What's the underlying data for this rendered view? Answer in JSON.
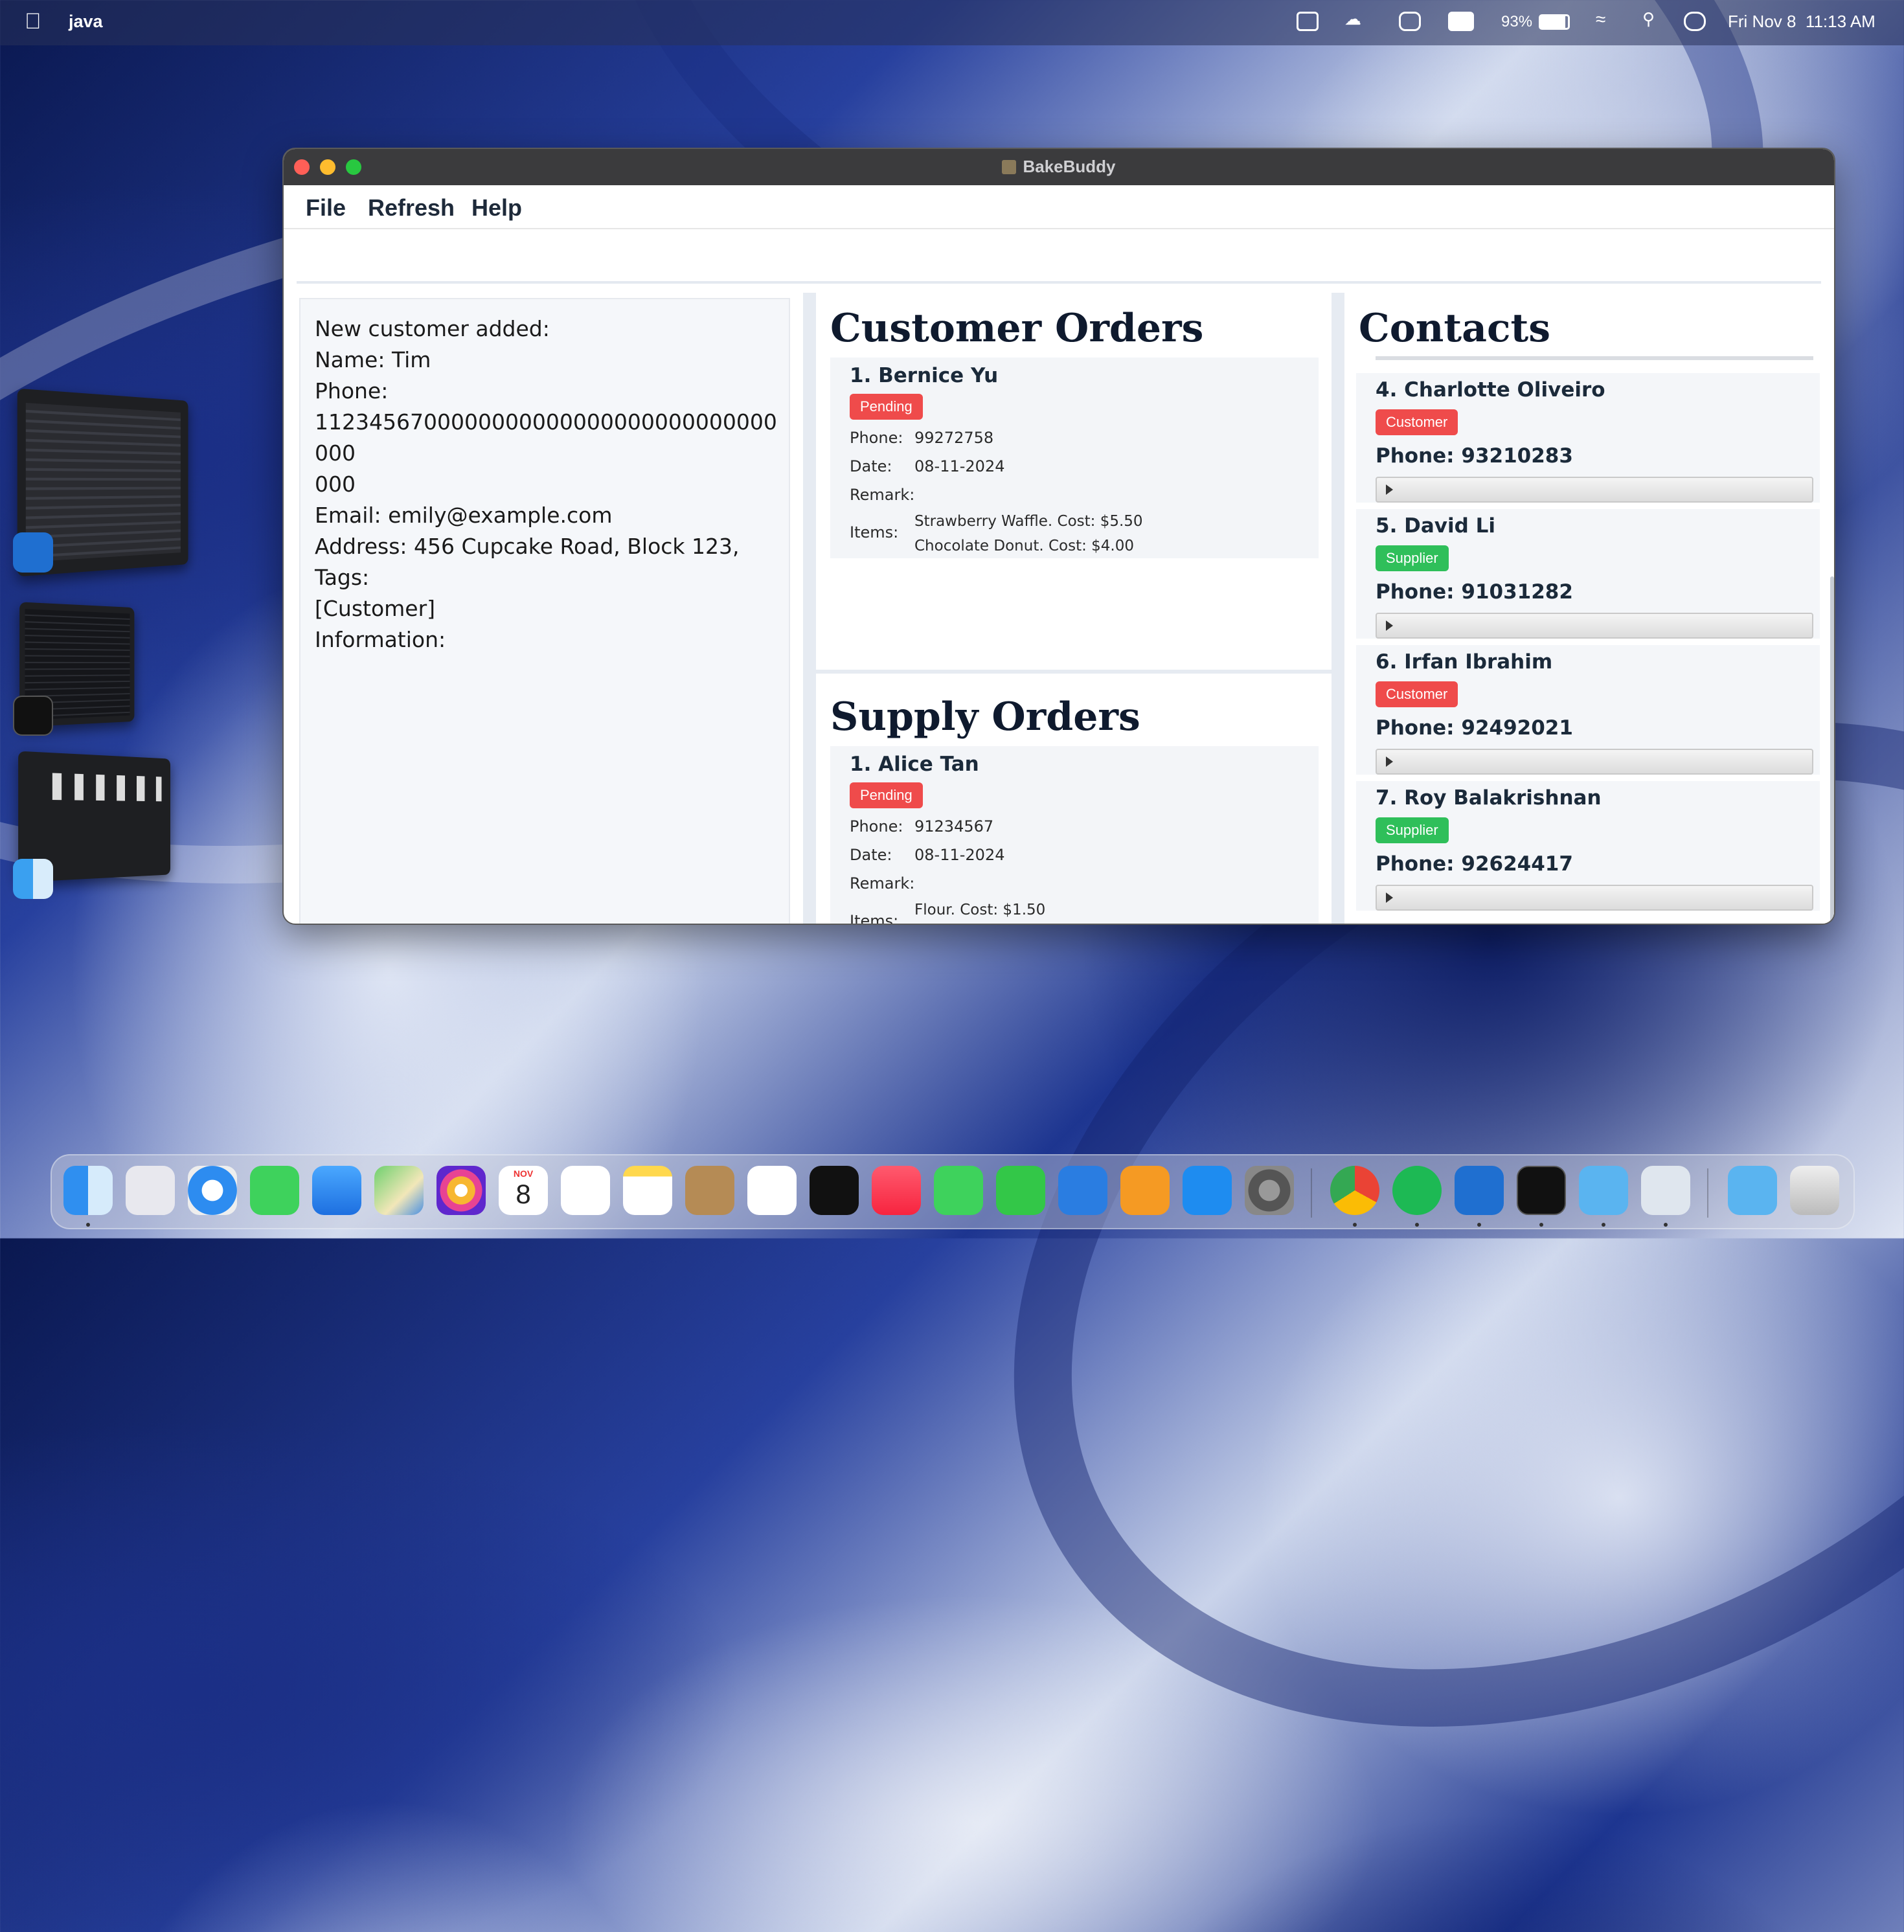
{
  "menubar": {
    "app_name": "java",
    "battery": "93%",
    "datetime": "Fri Nov 8  11:13 AM"
  },
  "window": {
    "title": "BakeBuddy",
    "menu": [
      "File",
      "Refresh",
      "Help"
    ]
  },
  "result": {
    "lines": [
      "New customer added:",
      "Name: Tim",
      "Phone:",
      "1123456700000000000000000000000000000",
      "000",
      "Email: emily@example.com",
      "Address: 456 Cupcake Road, Block 123,",
      "Tags:",
      "[Customer]",
      "Information:"
    ]
  },
  "customer_orders": {
    "heading": "Customer Orders",
    "orders": [
      {
        "name": "1. Bernice Yu",
        "status": "Pending",
        "phone_label": "Phone:",
        "phone": "99272758",
        "date_label": "Date:",
        "date": "08-11-2024",
        "remark_label": "Remark:",
        "items_label": "Items:",
        "items": [
          "Strawberry Waffle. Cost: $5.50",
          "Chocolate Donut. Cost: $4.00"
        ]
      }
    ]
  },
  "supply_orders": {
    "heading": "Supply Orders",
    "orders": [
      {
        "name": "1. Alice Tan",
        "status": "Pending",
        "phone_label": "Phone:",
        "phone": "91234567",
        "date_label": "Date:",
        "date": "08-11-2024",
        "remark_label": "Remark:",
        "items_label": "Items:",
        "items": [
          "Flour. Cost: $1.50"
        ]
      }
    ]
  },
  "contacts": {
    "heading": "Contacts",
    "items": [
      {
        "name": "4. Charlotte Oliveiro",
        "tag": "Customer",
        "phone": "Phone: 93210283"
      },
      {
        "name": "5. David Li",
        "tag": "Supplier",
        "phone": "Phone: 91031282"
      },
      {
        "name": "6. Irfan Ibrahim",
        "tag": "Customer",
        "phone": "Phone: 92492021"
      },
      {
        "name": "7. Roy Balakrishnan",
        "tag": "Supplier",
        "phone": "Phone: 92624417"
      }
    ]
  },
  "colors": {
    "pending": "#ef4b4b",
    "customer": "#ef4b4b",
    "supplier": "#2fbf5a"
  },
  "calendar": {
    "month": "NOV",
    "day": "8"
  },
  "dock_icons": [
    "finder-icon",
    "launchpad-icon",
    "safari-icon",
    "messages-icon",
    "mail-icon",
    "maps-icon",
    "photos-icon",
    "calendar-icon",
    "reminders-icon",
    "notes-icon",
    "contacts-icon",
    "freeform-icon",
    "apple-tv-icon",
    "music-icon",
    "facetime-icon",
    "numbers-icon",
    "keynote-icon",
    "pages-icon",
    "app-store-icon",
    "system-settings-icon",
    "chrome-icon",
    "spotify-icon",
    "outlook-icon",
    "terminal-icon",
    "folder-icon",
    "preview-icon",
    "downloads-folder-icon",
    "trash-icon"
  ]
}
